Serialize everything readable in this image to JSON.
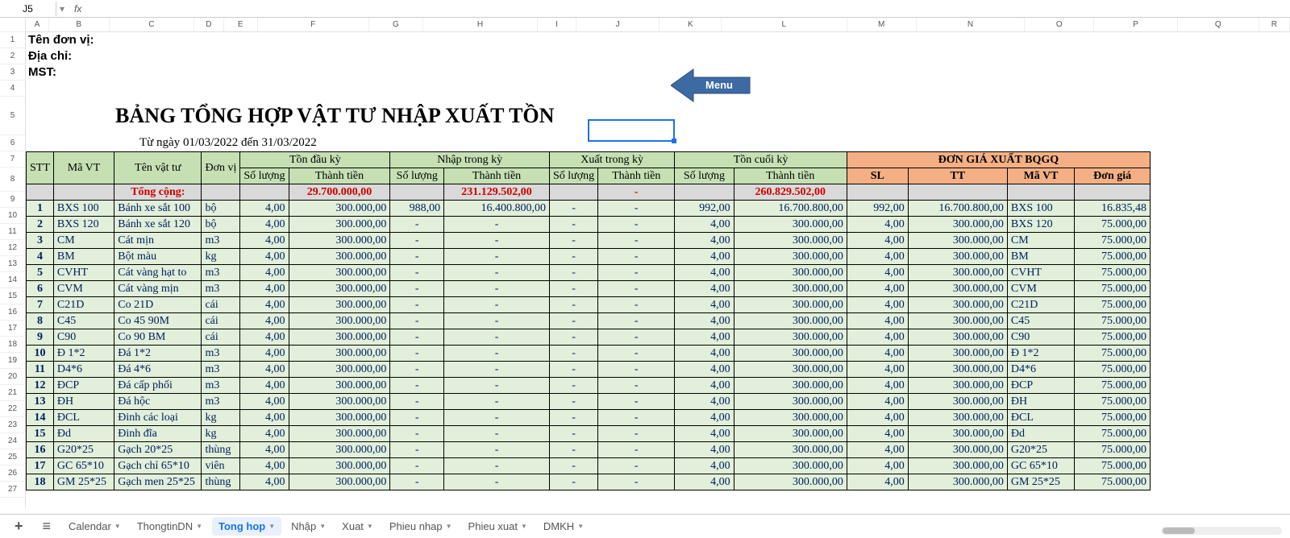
{
  "cellRef": "J5",
  "colWidths": {
    "A": 30,
    "B": 78,
    "C": 110,
    "D": 38,
    "E": 44,
    "F": 144,
    "G": 70,
    "H": 148,
    "I": 50,
    "J": 108,
    "K": 80,
    "L": 162,
    "M": 90,
    "N": 140,
    "O": 90,
    "P": 108,
    "Q": 105,
    "R": 40
  },
  "meta": {
    "l1": "Tên đơn vị:",
    "l2": "Địa chỉ:",
    "l3": "MST:"
  },
  "title": "BẢNG TỔNG HỢP VẬT TƯ NHẬP XUẤT TỒN",
  "subtitle": "Từ ngày 01/03/2022   đến 31/03/2022",
  "menuLabel": "Menu",
  "headers": {
    "stt": "STT",
    "mavt": "Mã VT",
    "tenvt": "Tên vật tư",
    "dvi": "Đơn vị",
    "tondk": "Tồn đầu kỳ",
    "nhaptk": "Nhập trong kỳ",
    "xuattk": "Xuất trong kỳ",
    "tonck": "Tồn cuối kỳ",
    "bqgq": "ĐƠN GIÁ XUẤT BQGQ",
    "sl": "Số lượng",
    "tt": "Thành tiền",
    "bq_sl": "SL",
    "bq_tt": "TT",
    "bq_mavt": "Mã VT",
    "bq_dg": "Đơn giá"
  },
  "total": {
    "label": "Tổng cộng:",
    "tdk_tt": "29.700.000,00",
    "nk_tt": "231.129.502,00",
    "xk_tt": "-",
    "tck_tt": "260.829.502,00"
  },
  "rows": [
    {
      "stt": "1",
      "mavt": "BXS 100",
      "ten": "Bánh xe sắt 100",
      "dv": "bộ",
      "tdk_sl": "4,00",
      "tdk_tt": "300.000,00",
      "nk_sl": "988,00",
      "nk_tt": "16.400.800,00",
      "xk_sl": "-",
      "xk_tt": "-",
      "tck_sl": "992,00",
      "tck_tt": "16.700.800,00",
      "bq_sl": "992,00",
      "bq_tt": "16.700.800,00",
      "bq_ma": "BXS 100",
      "bq_dg": "16.835,48"
    },
    {
      "stt": "2",
      "mavt": "BXS 120",
      "ten": "Bánh xe sắt 120",
      "dv": "bộ",
      "tdk_sl": "4,00",
      "tdk_tt": "300.000,00",
      "nk_sl": "-",
      "nk_tt": "-",
      "xk_sl": "-",
      "xk_tt": "-",
      "tck_sl": "4,00",
      "tck_tt": "300.000,00",
      "bq_sl": "4,00",
      "bq_tt": "300.000,00",
      "bq_ma": "BXS 120",
      "bq_dg": "75.000,00"
    },
    {
      "stt": "3",
      "mavt": "CM",
      "ten": "Cát mịn",
      "dv": "m3",
      "tdk_sl": "4,00",
      "tdk_tt": "300.000,00",
      "nk_sl": "-",
      "nk_tt": "-",
      "xk_sl": "-",
      "xk_tt": "-",
      "tck_sl": "4,00",
      "tck_tt": "300.000,00",
      "bq_sl": "4,00",
      "bq_tt": "300.000,00",
      "bq_ma": "CM",
      "bq_dg": "75.000,00"
    },
    {
      "stt": "4",
      "mavt": "BM",
      "ten": "Bột màu",
      "dv": "kg",
      "tdk_sl": "4,00",
      "tdk_tt": "300.000,00",
      "nk_sl": "-",
      "nk_tt": "-",
      "xk_sl": "-",
      "xk_tt": "-",
      "tck_sl": "4,00",
      "tck_tt": "300.000,00",
      "bq_sl": "4,00",
      "bq_tt": "300.000,00",
      "bq_ma": "BM",
      "bq_dg": "75.000,00"
    },
    {
      "stt": "5",
      "mavt": "CVHT",
      "ten": "Cát vàng hạt to",
      "dv": "m3",
      "tdk_sl": "4,00",
      "tdk_tt": "300.000,00",
      "nk_sl": "-",
      "nk_tt": "-",
      "xk_sl": "-",
      "xk_tt": "-",
      "tck_sl": "4,00",
      "tck_tt": "300.000,00",
      "bq_sl": "4,00",
      "bq_tt": "300.000,00",
      "bq_ma": "CVHT",
      "bq_dg": "75.000,00"
    },
    {
      "stt": "6",
      "mavt": "CVM",
      "ten": "Cát vàng mịn",
      "dv": "m3",
      "tdk_sl": "4,00",
      "tdk_tt": "300.000,00",
      "nk_sl": "-",
      "nk_tt": "-",
      "xk_sl": "-",
      "xk_tt": "-",
      "tck_sl": "4,00",
      "tck_tt": "300.000,00",
      "bq_sl": "4,00",
      "bq_tt": "300.000,00",
      "bq_ma": "CVM",
      "bq_dg": "75.000,00"
    },
    {
      "stt": "7",
      "mavt": "C21D",
      "ten": "Co 21D",
      "dv": "cái",
      "tdk_sl": "4,00",
      "tdk_tt": "300.000,00",
      "nk_sl": "-",
      "nk_tt": "-",
      "xk_sl": "-",
      "xk_tt": "-",
      "tck_sl": "4,00",
      "tck_tt": "300.000,00",
      "bq_sl": "4,00",
      "bq_tt": "300.000,00",
      "bq_ma": "C21D",
      "bq_dg": "75.000,00"
    },
    {
      "stt": "8",
      "mavt": "C45",
      "ten": "Co 45 90M",
      "dv": "cái",
      "tdk_sl": "4,00",
      "tdk_tt": "300.000,00",
      "nk_sl": "-",
      "nk_tt": "-",
      "xk_sl": "-",
      "xk_tt": "-",
      "tck_sl": "4,00",
      "tck_tt": "300.000,00",
      "bq_sl": "4,00",
      "bq_tt": "300.000,00",
      "bq_ma": "C45",
      "bq_dg": "75.000,00"
    },
    {
      "stt": "9",
      "mavt": "C90",
      "ten": "Co 90 BM",
      "dv": "cái",
      "tdk_sl": "4,00",
      "tdk_tt": "300.000,00",
      "nk_sl": "-",
      "nk_tt": "-",
      "xk_sl": "-",
      "xk_tt": "-",
      "tck_sl": "4,00",
      "tck_tt": "300.000,00",
      "bq_sl": "4,00",
      "bq_tt": "300.000,00",
      "bq_ma": "C90",
      "bq_dg": "75.000,00"
    },
    {
      "stt": "10",
      "mavt": "Đ 1*2",
      "ten": "Đá 1*2",
      "dv": "m3",
      "tdk_sl": "4,00",
      "tdk_tt": "300.000,00",
      "nk_sl": "-",
      "nk_tt": "-",
      "xk_sl": "-",
      "xk_tt": "-",
      "tck_sl": "4,00",
      "tck_tt": "300.000,00",
      "bq_sl": "4,00",
      "bq_tt": "300.000,00",
      "bq_ma": "Đ 1*2",
      "bq_dg": "75.000,00"
    },
    {
      "stt": "11",
      "mavt": "D4*6",
      "ten": "Đá 4*6",
      "dv": "m3",
      "tdk_sl": "4,00",
      "tdk_tt": "300.000,00",
      "nk_sl": "-",
      "nk_tt": "-",
      "xk_sl": "-",
      "xk_tt": "-",
      "tck_sl": "4,00",
      "tck_tt": "300.000,00",
      "bq_sl": "4,00",
      "bq_tt": "300.000,00",
      "bq_ma": "D4*6",
      "bq_dg": "75.000,00"
    },
    {
      "stt": "12",
      "mavt": "ĐCP",
      "ten": "Đá cấp phối",
      "dv": "m3",
      "tdk_sl": "4,00",
      "tdk_tt": "300.000,00",
      "nk_sl": "-",
      "nk_tt": "-",
      "xk_sl": "-",
      "xk_tt": "-",
      "tck_sl": "4,00",
      "tck_tt": "300.000,00",
      "bq_sl": "4,00",
      "bq_tt": "300.000,00",
      "bq_ma": "ĐCP",
      "bq_dg": "75.000,00"
    },
    {
      "stt": "13",
      "mavt": "ĐH",
      "ten": "Đá hộc",
      "dv": "m3",
      "tdk_sl": "4,00",
      "tdk_tt": "300.000,00",
      "nk_sl": "-",
      "nk_tt": "-",
      "xk_sl": "-",
      "xk_tt": "-",
      "tck_sl": "4,00",
      "tck_tt": "300.000,00",
      "bq_sl": "4,00",
      "bq_tt": "300.000,00",
      "bq_ma": "ĐH",
      "bq_dg": "75.000,00"
    },
    {
      "stt": "14",
      "mavt": "ĐCL",
      "ten": "Đinh các loại",
      "dv": "kg",
      "tdk_sl": "4,00",
      "tdk_tt": "300.000,00",
      "nk_sl": "-",
      "nk_tt": "-",
      "xk_sl": "-",
      "xk_tt": "-",
      "tck_sl": "4,00",
      "tck_tt": "300.000,00",
      "bq_sl": "4,00",
      "bq_tt": "300.000,00",
      "bq_ma": "ĐCL",
      "bq_dg": "75.000,00"
    },
    {
      "stt": "15",
      "mavt": "Đd",
      "ten": "Đinh đĩa",
      "dv": "kg",
      "tdk_sl": "4,00",
      "tdk_tt": "300.000,00",
      "nk_sl": "-",
      "nk_tt": "-",
      "xk_sl": "-",
      "xk_tt": "-",
      "tck_sl": "4,00",
      "tck_tt": "300.000,00",
      "bq_sl": "4,00",
      "bq_tt": "300.000,00",
      "bq_ma": "Đd",
      "bq_dg": "75.000,00"
    },
    {
      "stt": "16",
      "mavt": "G20*25",
      "ten": "Gạch 20*25",
      "dv": "thùng",
      "tdk_sl": "4,00",
      "tdk_tt": "300.000,00",
      "nk_sl": "-",
      "nk_tt": "-",
      "xk_sl": "-",
      "xk_tt": "-",
      "tck_sl": "4,00",
      "tck_tt": "300.000,00",
      "bq_sl": "4,00",
      "bq_tt": "300.000,00",
      "bq_ma": "G20*25",
      "bq_dg": "75.000,00"
    },
    {
      "stt": "17",
      "mavt": "GC 65*10",
      "ten": "Gạch chỉ 65*10",
      "dv": "viên",
      "tdk_sl": "4,00",
      "tdk_tt": "300.000,00",
      "nk_sl": "-",
      "nk_tt": "-",
      "xk_sl": "-",
      "xk_tt": "-",
      "tck_sl": "4,00",
      "tck_tt": "300.000,00",
      "bq_sl": "4,00",
      "bq_tt": "300.000,00",
      "bq_ma": "GC 65*10",
      "bq_dg": "75.000,00"
    },
    {
      "stt": "18",
      "mavt": "GM 25*25",
      "ten": "Gạch men 25*25",
      "dv": "thùng",
      "tdk_sl": "4,00",
      "tdk_tt": "300.000,00",
      "nk_sl": "-",
      "nk_tt": "-",
      "xk_sl": "-",
      "xk_tt": "-",
      "tck_sl": "4,00",
      "tck_tt": "300.000,00",
      "bq_sl": "4,00",
      "bq_tt": "300.000,00",
      "bq_ma": "GM 25*25",
      "bq_dg": "75.000,00"
    }
  ],
  "tabs": [
    "Calendar",
    "ThongtinDN",
    "Tong hop",
    "Nhập",
    "Xuat",
    "Phieu nhap",
    "Phieu xuat",
    "DMKH"
  ],
  "activeTab": 2
}
